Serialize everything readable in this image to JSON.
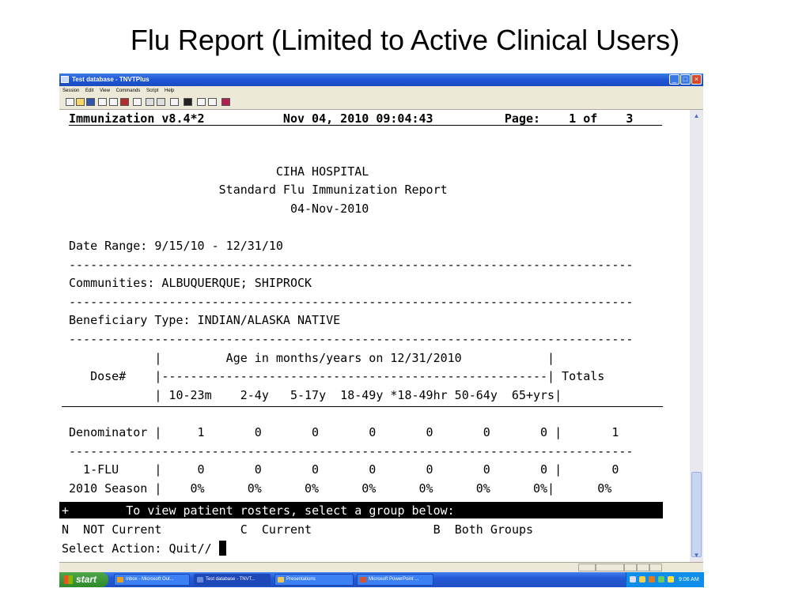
{
  "slide": {
    "title": "Flu Report (Limited to Active Clinical Users)"
  },
  "window": {
    "title": "Test database - TNVTPlus",
    "controls": {
      "minimize": "_",
      "maximize": "□",
      "close": "×"
    },
    "menu": [
      "Session",
      "Edit",
      "View",
      "Commands",
      "Script",
      "Help"
    ],
    "toolbar_icons": [
      "new-icon",
      "open-icon",
      "save-icon",
      "properties-icon",
      "grid-icon",
      "record-icon",
      "print-icon",
      "copy-icon",
      "paste-icon",
      "display-icon",
      "keyboard-icon",
      "transfer-icon",
      "macro-icon",
      "run-icon"
    ]
  },
  "terminal": {
    "header_line": "Immunization v8.4*2           Nov 04, 2010 09:04:43          Page:    1 of    3 ",
    "lines": [
      "",
      "                             CIHA HOSPITAL",
      "                     Standard Flu Immunization Report",
      "                               04-Nov-2010",
      "",
      "Date Range: 9/15/10 - 12/31/10",
      "-------------------------------------------------------------------------------",
      "Communities: ALBUQUERQUE; SHIPROCK",
      "-------------------------------------------------------------------------------",
      "Beneficiary Type: INDIAN/ALASKA NATIVE",
      "-------------------------------------------------------------------------------",
      "            |         Age in months/years on 12/31/2010            |",
      "   Dose#    |------------------------------------------------------| Totals",
      "            | 10-23m    2-4y   5-17y  18-49y *18-49hr 50-64y  65+yrs|",
      "",
      "Denominator |     1       0       0       0       0       0       0 |       1",
      "-------------------------------------------------------------------------------",
      "  1-FLU     |     0       0       0       0       0       0       0 |       0",
      "2010 Season |    0%      0%      0%      0%      0%      0%      0%|      0%",
      "-------------------------------------------------------------------------------"
    ],
    "prompt_bar": "+        To view patient rosters, select a group below:",
    "options_line": "N  NOT Current           C  Current                 B  Both Groups",
    "select_line": "Select Action: Quit// "
  },
  "taskbar": {
    "start_label": "start",
    "buttons": [
      {
        "label": "Inbox - Microsoft Out...",
        "color": "#e8a020"
      },
      {
        "label": "Test database - TNVT...",
        "color": "#6a8ad8"
      },
      {
        "label": "Presentations",
        "color": "#f0c850"
      },
      {
        "label": "Microsoft PowerPoint ...",
        "color": "#d9532b"
      }
    ],
    "clock": "9:06 AM"
  }
}
